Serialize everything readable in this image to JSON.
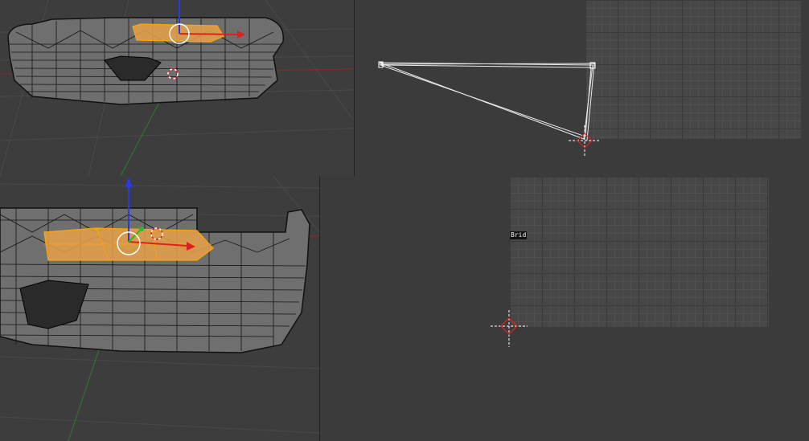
{
  "viewport_top_left": {
    "name": "3d-viewport-top"
  },
  "viewport_bottom_left": {
    "name": "3d-viewport-bottom"
  },
  "uv_editor_top": {
    "name": "uv-editor-top"
  },
  "uv_editor_bottom": {
    "name": "uv-editor-bottom",
    "label": "Brid"
  },
  "colors": {
    "background": "#3a3a3a",
    "mesh_fill": "#6f6f6f",
    "wire": "#000000",
    "selection": "#f5a623",
    "axis_x": "#e02020",
    "axis_y": "#20c020",
    "axis_z": "#2030e0",
    "grid_dark": "#3a3a3a",
    "grid_light": "#4f4f4f"
  },
  "icons": [
    "3d-cursor-icon",
    "transform-gizmo-icon"
  ]
}
